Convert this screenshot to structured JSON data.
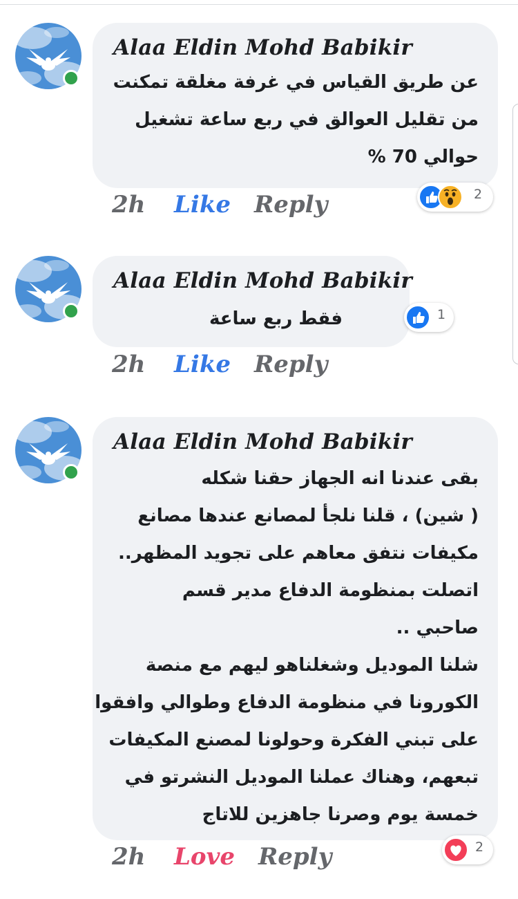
{
  "comments": [
    {
      "author": "Alaa Eldin Mohd Babikir",
      "lines": [
        "عن طريق القياس في غرفة مغلقة تمكنت",
        "من تقليل العوالق في ربع ساعة تشغيل",
        "حوالي 70 %"
      ],
      "time": "2h",
      "action_label": "Like",
      "reply_label": "Reply",
      "reactions": [
        "like-icon",
        "wow-icon"
      ],
      "reaction_count": "2"
    },
    {
      "author": "Alaa Eldin Mohd Babikir",
      "lines": [
        "فقط ربع ساعة"
      ],
      "time": "2h",
      "action_label": "Like",
      "reply_label": "Reply",
      "reactions": [
        "like-icon"
      ],
      "reaction_count": "1"
    },
    {
      "author": "Alaa Eldin Mohd Babikir",
      "lines": [
        "بقى عندنا انه الجهاز حقنا شكله",
        "( شين) ، قلنا نلجأ لمصانع عندها مصانع",
        "مكيفات نتفق معاهم على تجويد المظهر..",
        "اتصلت بمنظومة الدفاع مدير قسم",
        "صاحبي ..",
        "شلنا الموديل وشغلناهو ليهم مع منصة",
        "الكورونا في منظومة الدفاع وطوالي وافقوا",
        "على تبني الفكرة وحولونا لمصنع المكيفات",
        "تبعهم، وهناك عملنا الموديل النشرتو في",
        "خمسة يوم وصرنا جاهزين للاتاج"
      ],
      "time": "2h",
      "action_label": "Love",
      "reply_label": "Reply",
      "reactions": [
        "love-icon"
      ],
      "reaction_count": "2"
    }
  ],
  "colors": {
    "bubble": "#f0f2f5",
    "like": "#3578e5",
    "love": "#e8456b",
    "online": "#31a24c",
    "muted": "#65676b"
  }
}
